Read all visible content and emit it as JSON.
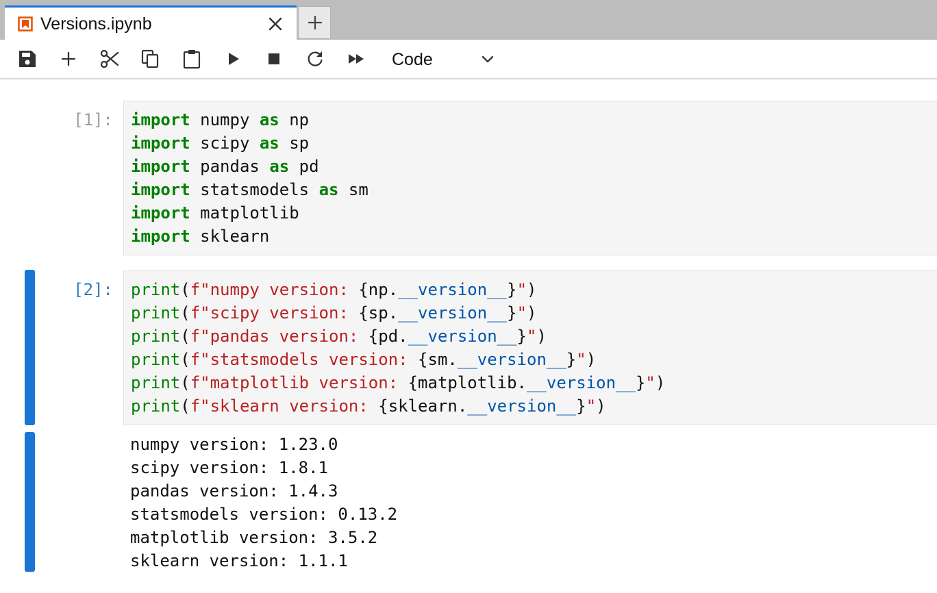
{
  "tab": {
    "title": "Versions.ipynb",
    "close_icon": "close-icon",
    "new_tab_icon": "plus-icon",
    "accent": "#1976d2",
    "icon_color": "#e65100"
  },
  "toolbar": {
    "icons": [
      "save-icon",
      "plus-icon",
      "scissors-icon",
      "copy-icon",
      "paste-icon",
      "run-icon",
      "stop-icon",
      "restart-icon",
      "fast-forward-icon"
    ],
    "cell_type": "Code"
  },
  "cells": [
    {
      "prompt": "[1]:",
      "lines": [
        {
          "kw1": "import",
          "mod": "numpy",
          "kw2": "as",
          "alias": "np"
        },
        {
          "kw1": "import",
          "mod": "scipy",
          "kw2": "as",
          "alias": "sp"
        },
        {
          "kw1": "import",
          "mod": "pandas",
          "kw2": "as",
          "alias": "pd"
        },
        {
          "kw1": "import",
          "mod": "statsmodels",
          "kw2": "as",
          "alias": "sm"
        },
        {
          "kw1": "import",
          "mod": "matplotlib",
          "kw2": "",
          "alias": ""
        },
        {
          "kw1": "import",
          "mod": "sklearn",
          "kw2": "",
          "alias": ""
        }
      ]
    },
    {
      "prompt": "[2]:",
      "lines": [
        {
          "fn": "print",
          "open": "(",
          "prefix": "f\"",
          "label": "numpy version: ",
          "obj": "{np.",
          "attr": "__version__",
          "close_brace": "}",
          "end_quote": "\"",
          "close": ")"
        },
        {
          "fn": "print",
          "open": "(",
          "prefix": "f\"",
          "label": "scipy version: ",
          "obj": "{sp.",
          "attr": "__version__",
          "close_brace": "}",
          "end_quote": "\"",
          "close": ")"
        },
        {
          "fn": "print",
          "open": "(",
          "prefix": "f\"",
          "label": "pandas version: ",
          "obj": "{pd.",
          "attr": "__version__",
          "close_brace": "}",
          "end_quote": "\"",
          "close": ")"
        },
        {
          "fn": "print",
          "open": "(",
          "prefix": "f\"",
          "label": "statsmodels version: ",
          "obj": "{sm.",
          "attr": "__version__",
          "close_brace": "}",
          "end_quote": "\"",
          "close": ")"
        },
        {
          "fn": "print",
          "open": "(",
          "prefix": "f\"",
          "label": "matplotlib version: ",
          "obj": "{matplotlib.",
          "attr": "__version__",
          "close_brace": "}",
          "end_quote": "\"",
          "close": ")"
        },
        {
          "fn": "print",
          "open": "(",
          "prefix": "f\"",
          "label": "sklearn version: ",
          "obj": "{sklearn.",
          "attr": "__version__",
          "close_brace": "}",
          "end_quote": "\"",
          "close": ")"
        }
      ],
      "output": [
        "numpy version: 1.23.0",
        "scipy version: 1.8.1",
        "pandas version: 1.4.3",
        "statsmodels version: 0.13.2",
        "matplotlib version: 3.5.2",
        "sklearn version: 1.1.1"
      ]
    }
  ]
}
